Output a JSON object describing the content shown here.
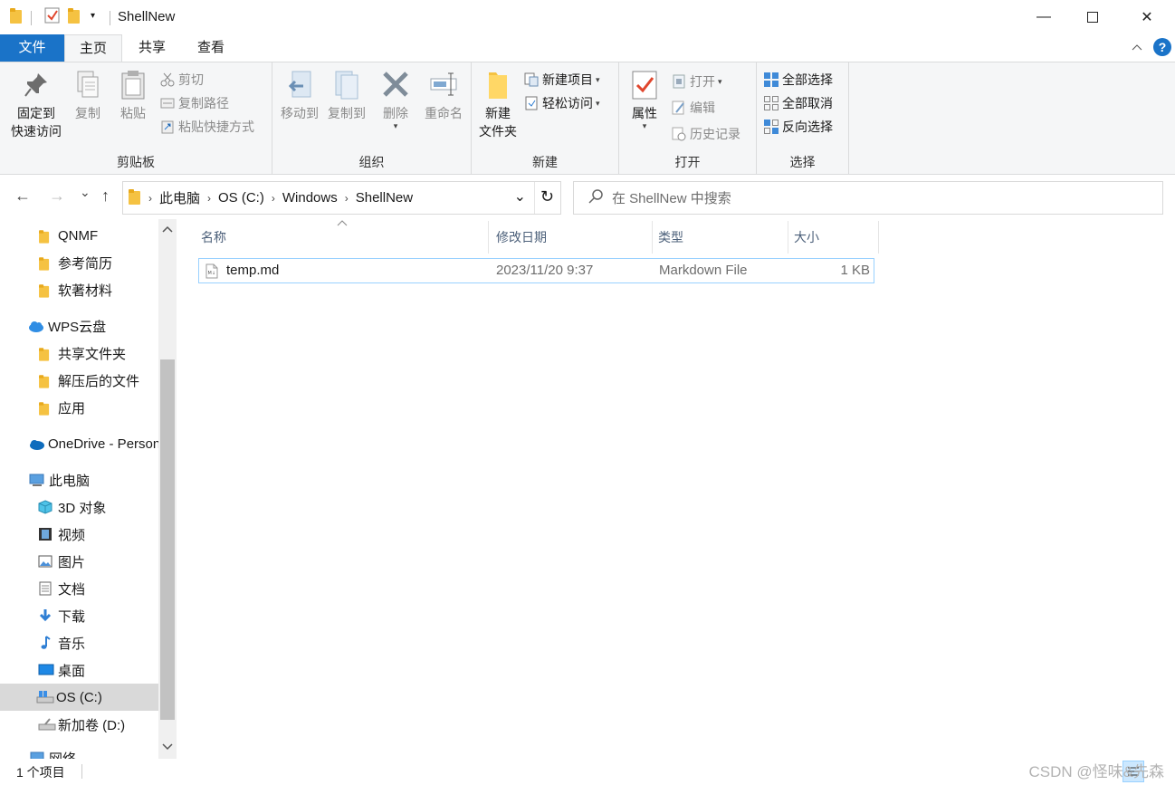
{
  "window": {
    "title": "ShellNew",
    "minimize": "—",
    "maximize": "☐",
    "close": "✕"
  },
  "ribbon_tabs": {
    "file": "文件",
    "home": "主页",
    "share": "共享",
    "view": "查看",
    "help": "?",
    "collapse": "^"
  },
  "ribbon": {
    "clipboard": {
      "label": "剪贴板",
      "pin_line1": "固定到",
      "pin_line2": "快速访问",
      "copy": "复制",
      "paste": "粘贴",
      "cut": "剪切",
      "copy_path": "复制路径",
      "paste_shortcut": "粘贴快捷方式"
    },
    "organize": {
      "label": "组织",
      "move_to": "移动到",
      "copy_to": "复制到",
      "delete": "删除",
      "rename": "重命名"
    },
    "new": {
      "label": "新建",
      "new_folder_line1": "新建",
      "new_folder_line2": "文件夹",
      "new_item": "新建项目",
      "easy_access": "轻松访问"
    },
    "open": {
      "label": "打开",
      "properties": "属性",
      "open": "打开",
      "edit": "编辑",
      "history": "历史记录"
    },
    "select": {
      "label": "选择",
      "select_all": "全部选择",
      "select_none": "全部取消",
      "invert": "反向选择"
    }
  },
  "navigation": {
    "back": "←",
    "forward": "→",
    "recent": "⌄",
    "up": "↑",
    "breadcrumb": [
      "此电脑",
      "OS (C:)",
      "Windows",
      "ShellNew"
    ],
    "refresh": "↻",
    "dropdown": "⌄",
    "search_placeholder": "在 ShellNew 中搜索"
  },
  "nav_pane": {
    "items": [
      {
        "label": "QNMF",
        "icon": "folder-icon"
      },
      {
        "label": "参考简历",
        "icon": "folder-icon"
      },
      {
        "label": "软著材料",
        "icon": "folder-icon"
      },
      {
        "label": "WPS云盘",
        "icon": "cloud-icon"
      },
      {
        "label": "共享文件夹",
        "icon": "shared-folder-icon"
      },
      {
        "label": "解压后的文件",
        "icon": "folder-icon"
      },
      {
        "label": "应用",
        "icon": "shared-folder-icon"
      },
      {
        "label": "OneDrive - Personal",
        "icon": "onedrive-icon"
      },
      {
        "label": "此电脑",
        "icon": "pc-icon"
      },
      {
        "label": "3D 对象",
        "icon": "cube-icon"
      },
      {
        "label": "视频",
        "icon": "video-icon"
      },
      {
        "label": "图片",
        "icon": "picture-icon"
      },
      {
        "label": "文档",
        "icon": "document-icon"
      },
      {
        "label": "下载",
        "icon": "download-icon"
      },
      {
        "label": "音乐",
        "icon": "music-icon"
      },
      {
        "label": "桌面",
        "icon": "desktop-icon"
      },
      {
        "label": "OS (C:)",
        "icon": "drive-c-icon"
      },
      {
        "label": "新加卷 (D:)",
        "icon": "drive-icon"
      },
      {
        "label": "网络",
        "icon": "network-icon"
      }
    ]
  },
  "file_list": {
    "columns": {
      "name": "名称",
      "modified": "修改日期",
      "type": "类型",
      "size": "大小"
    },
    "rows": [
      {
        "name": "temp.md",
        "modified": "2023/11/20 9:37",
        "type": "Markdown File",
        "size": "1 KB"
      }
    ]
  },
  "status": {
    "count": "1 个项目",
    "watermark": "CSDN @怪味&先森"
  },
  "colors": {
    "accent": "#1a73c8",
    "folder": "#f5c242",
    "selection": "#cce8ff"
  }
}
